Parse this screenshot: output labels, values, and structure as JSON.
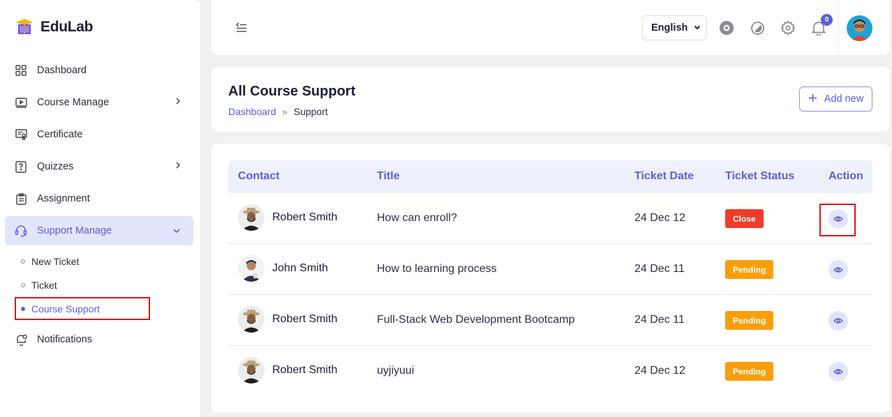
{
  "app": {
    "name": "EduLab"
  },
  "sidebar": {
    "items": [
      {
        "label": "Dashboard",
        "icon": "dashboard-grid-icon"
      },
      {
        "label": "Course Manage",
        "icon": "video-play-icon"
      },
      {
        "label": "Certificate",
        "icon": "certificate-icon"
      },
      {
        "label": "Quizzes",
        "icon": "quiz-icon"
      },
      {
        "label": "Assignment",
        "icon": "clipboard-icon"
      },
      {
        "label": "Support Manage",
        "icon": "headset-icon"
      },
      {
        "label": "Notifications",
        "icon": "bell-icon"
      }
    ],
    "sub_items": [
      {
        "label": "New Ticket"
      },
      {
        "label": "Ticket"
      },
      {
        "label": "Course Support"
      }
    ]
  },
  "topbar": {
    "language": "English",
    "notification_count": "0"
  },
  "header": {
    "title": "All Course Support",
    "breadcrumb": {
      "home": "Dashboard",
      "separator": "»",
      "current": "Support"
    },
    "add_button": "Add new"
  },
  "table": {
    "columns": [
      "Contact",
      "Title",
      "Ticket Date",
      "Ticket Status",
      "Action"
    ],
    "rows": [
      {
        "contact": "Robert Smith",
        "title": "How can enroll?",
        "date": "24 Dec 12",
        "status": "Close"
      },
      {
        "contact": "John Smith",
        "title": "How to learning process",
        "date": "24 Dec 11",
        "status": "Pending"
      },
      {
        "contact": "Robert Smith",
        "title": "Full-Stack Web Development Bootcamp",
        "date": "24 Dec 11",
        "status": "Pending"
      },
      {
        "contact": "Robert Smith",
        "title": "uyjiyuui",
        "date": "24 Dec 12",
        "status": "Pending"
      }
    ]
  },
  "colors": {
    "accent": "#5a5fe0",
    "status_close": "#f23b2a",
    "status_pending": "#fb9e0b",
    "highlight": "#e01515"
  }
}
